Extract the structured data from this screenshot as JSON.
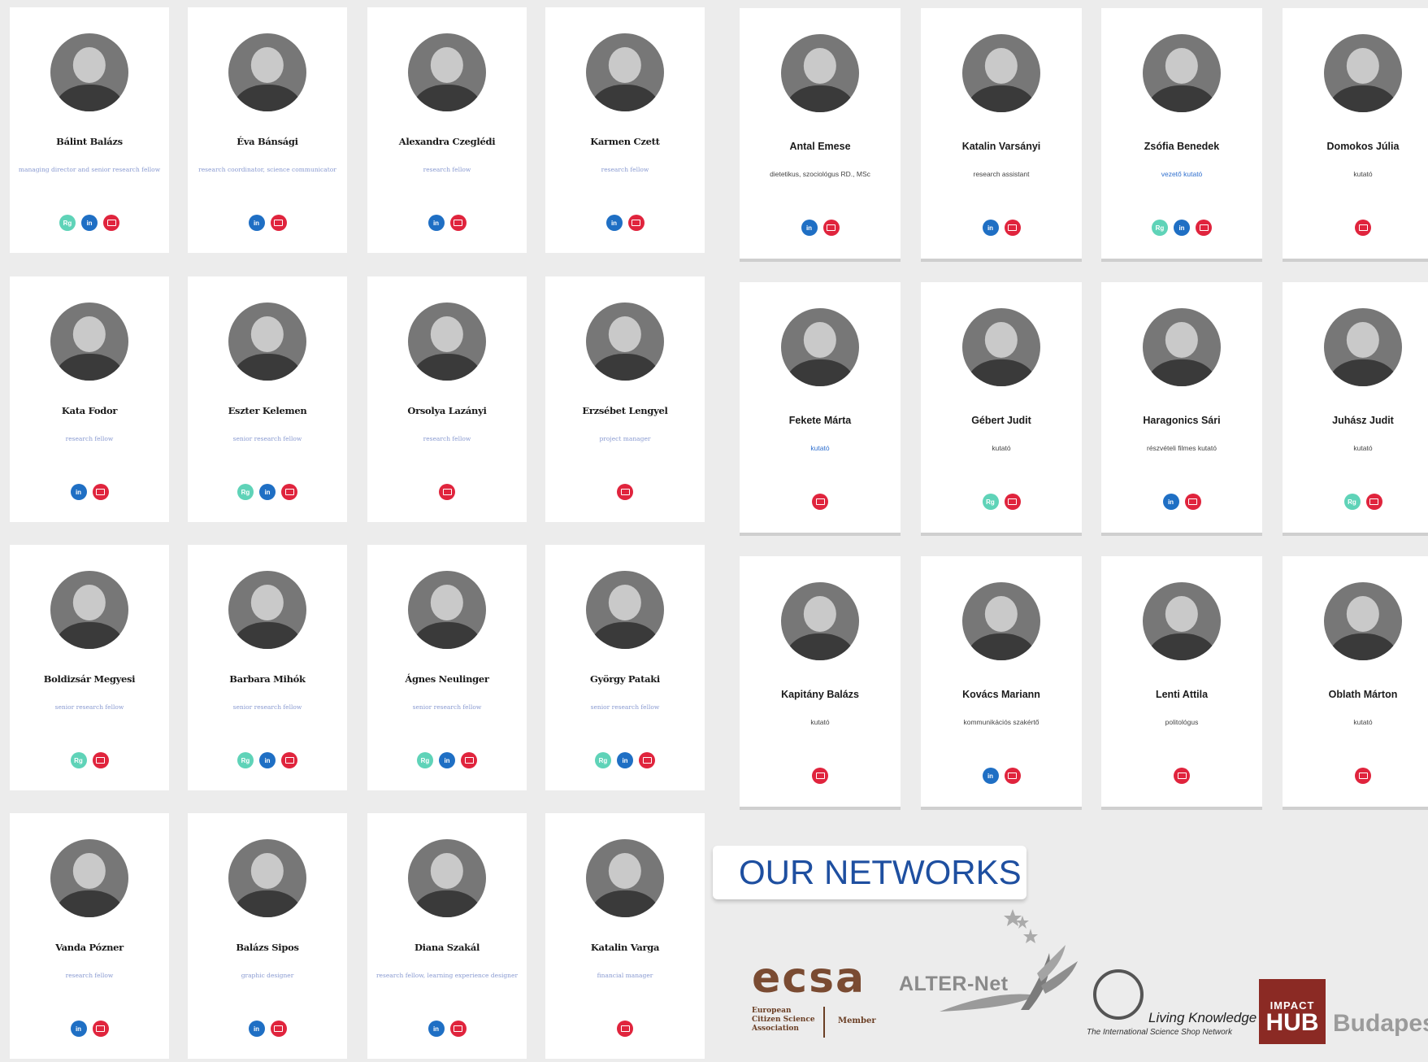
{
  "left_grid": [
    {
      "name": "Bálint Balázs",
      "role": "managing director and senior research fellow",
      "icons": [
        "rg",
        "in",
        "mail"
      ]
    },
    {
      "name": "Éva Bánsági",
      "role": "research coordinator, science communicator",
      "icons": [
        "in",
        "mail"
      ]
    },
    {
      "name": "Alexandra Czeglédi",
      "role": "research fellow",
      "icons": [
        "in",
        "mail"
      ]
    },
    {
      "name": "Karmen Czett",
      "role": "research fellow",
      "icons": [
        "in",
        "mail"
      ]
    },
    {
      "name": "Kata Fodor",
      "role": "research fellow",
      "icons": [
        "in",
        "mail"
      ]
    },
    {
      "name": "Eszter Kelemen",
      "role": "senior research fellow",
      "icons": [
        "rg",
        "in",
        "mail"
      ]
    },
    {
      "name": "Orsolya Lazányi",
      "role": "research fellow",
      "icons": [
        "mail"
      ]
    },
    {
      "name": "Erzsébet Lengyel",
      "role": "project manager",
      "icons": [
        "mail"
      ]
    },
    {
      "name": "Boldizsár Megyesi",
      "role": "senior research fellow",
      "icons": [
        "rg",
        "mail"
      ]
    },
    {
      "name": "Barbara Mihók",
      "role": "senior research fellow",
      "icons": [
        "rg",
        "in",
        "mail"
      ]
    },
    {
      "name": "Ágnes Neulinger",
      "role": "senior research fellow",
      "icons": [
        "rg",
        "in",
        "mail"
      ]
    },
    {
      "name": "György Pataki",
      "role": "senior research fellow",
      "icons": [
        "rg",
        "in",
        "mail"
      ]
    },
    {
      "name": "Vanda Pózner",
      "role": "research fellow",
      "icons": [
        "in",
        "mail"
      ]
    },
    {
      "name": "Balázs Sipos",
      "role": "graphic designer",
      "icons": [
        "in",
        "mail"
      ]
    },
    {
      "name": "Diana Szakál",
      "role": "research fellow, learning experience designer",
      "icons": [
        "in",
        "mail"
      ]
    },
    {
      "name": "Katalin Varga",
      "role": "financial manager",
      "icons": [
        "mail"
      ]
    }
  ],
  "right_grid": [
    {
      "name": "Antal Emese",
      "role": "dietetikus, szociológus RD., MSc",
      "role_link": false,
      "icons": [
        "in",
        "mail"
      ]
    },
    {
      "name": "Katalin Varsányi",
      "role": "research assistant",
      "role_link": false,
      "icons": [
        "in",
        "mail"
      ]
    },
    {
      "name": "Zsófia Benedek",
      "role": "vezető kutató",
      "role_link": true,
      "icons": [
        "rg",
        "in",
        "mail"
      ]
    },
    {
      "name": "Domokos Júlia",
      "role": "kutató",
      "role_link": false,
      "icons": [
        "mail"
      ]
    },
    {
      "name": "Fekete Márta",
      "role": "kutató",
      "role_link": true,
      "icons": [
        "mail"
      ]
    },
    {
      "name": "Gébert Judit",
      "role": "kutató",
      "role_link": false,
      "icons": [
        "rg",
        "mail"
      ]
    },
    {
      "name": "Haragonics Sári",
      "role": "részvételi filmes kutató",
      "role_link": false,
      "icons": [
        "in",
        "mail"
      ]
    },
    {
      "name": "Juhász Judit",
      "role": "kutató",
      "role_link": false,
      "icons": [
        "rg",
        "mail"
      ]
    },
    {
      "name": "Kapitány Balázs",
      "role": "kutató",
      "role_link": false,
      "icons": [
        "mail"
      ]
    },
    {
      "name": "Kovács Mariann",
      "role": "kommunikációs szakértő",
      "role_link": false,
      "icons": [
        "in",
        "mail"
      ]
    },
    {
      "name": "Lenti Attila",
      "role": "politológus",
      "role_link": false,
      "icons": [
        "mail"
      ]
    },
    {
      "name": "Oblath Márton",
      "role": "kutató",
      "role_link": false,
      "icons": [
        "mail"
      ]
    }
  ],
  "icon_labels": {
    "rg": "Rg",
    "in": "in",
    "mail": ""
  },
  "icon_names": {
    "rg": "researchgate-icon",
    "in": "linkedin-icon",
    "mail": "email-icon"
  },
  "colors": {
    "rg": "#5fd3b8",
    "in": "#1f6fc4",
    "mail": "#e0243d",
    "networks_title": "#1e4fa0"
  },
  "networks": {
    "title": "OUR NETWORKS",
    "ecsa": {
      "word": "ecsa",
      "lines": [
        "European",
        "Citizen Science",
        "Association"
      ],
      "member": "Member"
    },
    "alternet": {
      "text": "ALTER-Net"
    },
    "living_knowledge": {
      "title": "Living Knowledge",
      "subtitle": "The International Science Shop Network"
    },
    "impact_hub": {
      "top": "IMPACT",
      "mid": "HUB",
      "city": "Budapes"
    }
  }
}
